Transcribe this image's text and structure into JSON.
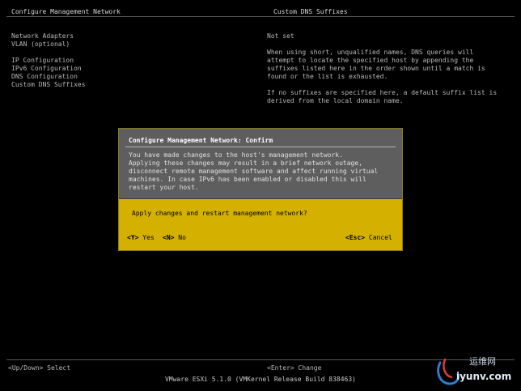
{
  "header": {
    "left_title": "Configure Management Network",
    "right_title": "Custom DNS Suffixes"
  },
  "menu": {
    "group1": [
      "Network Adapters",
      "VLAN (optional)"
    ],
    "group2": [
      "IP Configuration",
      "IPv6 Configuration",
      "DNS Configuration",
      "Custom DNS Suffixes"
    ]
  },
  "details": {
    "status": "Not set",
    "paragraph1": "When using short, unqualified names, DNS queries will\nattempt to locate the specified host by appending the\nsuffixes listed here in the order shown until a match is\nfound or the list is exhausted.",
    "paragraph2": "If no suffixes are specified here, a default suffix list is\nderived from the local domain name."
  },
  "dialog": {
    "title": "Configure Management Network: Confirm",
    "body": "You have made changes to the host's management network.\nApplying these changes may result in a brief network outage,\ndisconnect remote management software and affect running virtual\nmachines. In case IPv6 has been enabled or disabled this will\nrestart your host.",
    "question": "Apply changes and restart management network?",
    "yes_key": "<Y>",
    "yes_label": "Yes",
    "no_key": "<N>",
    "no_label": "No",
    "cancel_key": "<Esc>",
    "cancel_label": "Cancel"
  },
  "footer": {
    "left_hint": "<Up/Down> Select",
    "right_hint": "<Enter> Change",
    "status_line": "VMware ESXi 5.1.0 (VMKernel Release Build 838463)"
  },
  "watermark": {
    "cn_text": "运维网",
    "url": "iyunv.com"
  },
  "colors": {
    "background": "#000000",
    "text": "#b8b8b8",
    "dialog_header": "#5e5e5e",
    "dialog_accent": "#d4b100"
  }
}
